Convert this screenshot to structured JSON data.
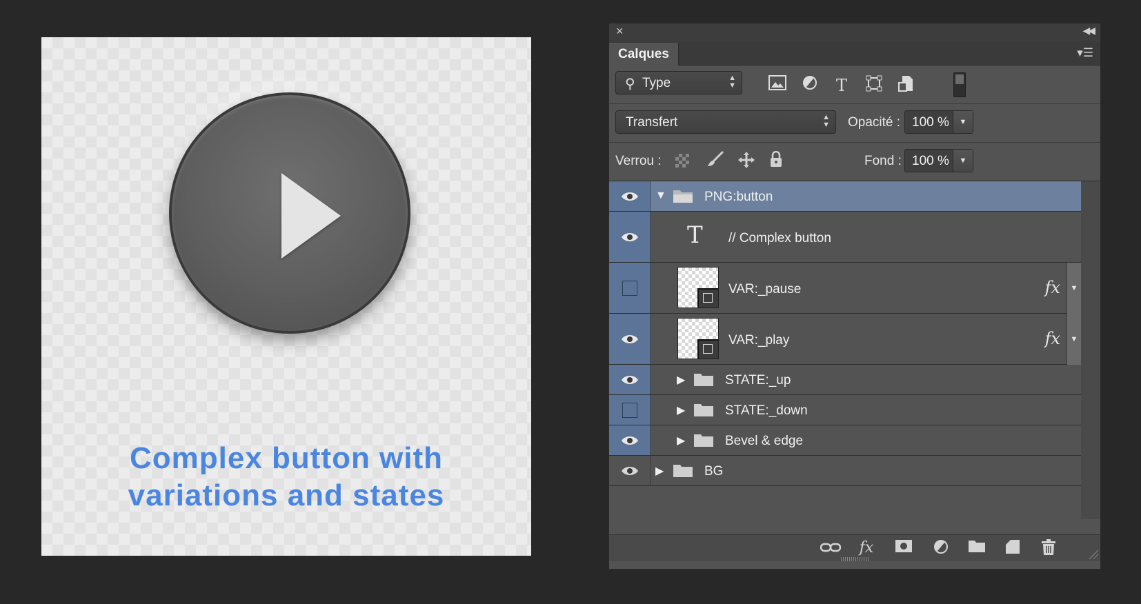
{
  "canvas": {
    "caption_line1": "Complex button with",
    "caption_line2": "variations and states",
    "caption_color": "#4a86e0"
  },
  "panel": {
    "close_label": "×",
    "collapse_label": "◀◀",
    "tab_label": "Calques",
    "menu_icon": "panel-menu-icon",
    "filter_kind": "Type",
    "filter_icons": [
      "image-filter-icon",
      "adjustment-filter-icon",
      "type-filter-icon",
      "shape-filter-icon",
      "smart-object-filter-icon"
    ],
    "blend_mode": "Transfert",
    "opacity_label": "Opacité :",
    "opacity_value": "100 %",
    "lock_label": "Verrou :",
    "lock_icons": [
      "lock-transparent-icon",
      "lock-pixels-icon",
      "lock-position-icon",
      "lock-all-icon"
    ],
    "fill_label": "Fond :",
    "fill_value": "100 %",
    "selection_color": "#6d819e"
  },
  "layers": [
    {
      "name": "PNG:button",
      "type": "group-open",
      "visible": true,
      "selected": true
    },
    {
      "name": "// Complex button",
      "type": "text",
      "visible": true
    },
    {
      "name": "VAR:_pause",
      "type": "smart",
      "visible": false,
      "fx": "fx"
    },
    {
      "name": "VAR:_play",
      "type": "smart",
      "visible": true,
      "fx": "fx"
    },
    {
      "name": "STATE:_up",
      "type": "group",
      "visible": true
    },
    {
      "name": "STATE:_down",
      "type": "group",
      "visible": false
    },
    {
      "name": "Bevel & edge",
      "type": "group",
      "visible": true
    },
    {
      "name": "BG",
      "type": "group",
      "visible": true
    }
  ],
  "bottom_icons": [
    "link-icon",
    "fx-icon",
    "mask-icon",
    "adjustment-icon",
    "new-group-icon",
    "new-layer-icon",
    "trash-icon"
  ]
}
